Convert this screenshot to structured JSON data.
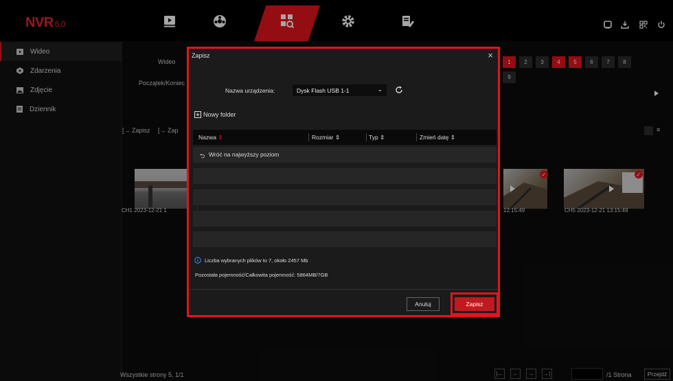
{
  "app": {
    "logo": "NVR",
    "version": "6.0"
  },
  "topnav": {
    "items": [
      "playback-icon",
      "camera-icon",
      "search-icon",
      "gear-icon",
      "maintenance-icon"
    ],
    "active_index": 2,
    "right_icons": [
      "alarm-icon",
      "download-icon",
      "qr-icon",
      "power-icon"
    ]
  },
  "sidebar": {
    "items": [
      {
        "label": "Wideo",
        "icon": "video-icon"
      },
      {
        "label": "Zdarzenia",
        "icon": "events-icon"
      },
      {
        "label": "Zdjęcie",
        "icon": "photo-icon"
      },
      {
        "label": "Dziennik",
        "icon": "log-icon"
      }
    ],
    "active_index": 0
  },
  "main": {
    "video_label": "Wideo",
    "range_label": "Początek/Koniec",
    "channels_row1": [
      "1",
      "2",
      "3",
      "4",
      "5",
      "6",
      "7",
      "8"
    ],
    "channels_row2": [
      "9"
    ],
    "selected_channels": [
      "1",
      "4",
      "5"
    ],
    "toolbar": {
      "save_label": "Zapisz",
      "save2_label": "Zap"
    },
    "thumbs": [
      {
        "caption": "CH1 2023-12-21 1",
        "checked": false
      },
      {
        "caption": "12:15:49",
        "checked": true
      },
      {
        "caption": "CH5 2023-12-21 13:15:49",
        "checked": true
      }
    ],
    "footer": {
      "all_pages": "Wszystkie strony 5, 1/1",
      "page_suffix": "/1 Strona",
      "goto": "Przejdź"
    }
  },
  "dialog": {
    "title": "Zapisz",
    "device_label": "Nazwa urządzenia:",
    "device_value": "Dysk Flash USB 1-1",
    "new_folder": "Nowy folder",
    "columns": {
      "name": "Nazwa",
      "size": "Rozmiar",
      "type": "Typ",
      "date": "Zmień datę"
    },
    "rows": [
      "Wróć na najwyższy poziom",
      "",
      "",
      "",
      ""
    ],
    "info": "Liczba wybranych plików to 7, około 2457 Mb",
    "capacity": "Pozostała pojemność/Całkowita pojemność: 5864MB/7GB",
    "cancel_label": "Anuluj",
    "save_label": "Zapisz"
  },
  "colors": {
    "accent": "#e3141c",
    "background": "#0a0a0a",
    "dialog_bg": "#1b1b1b"
  }
}
